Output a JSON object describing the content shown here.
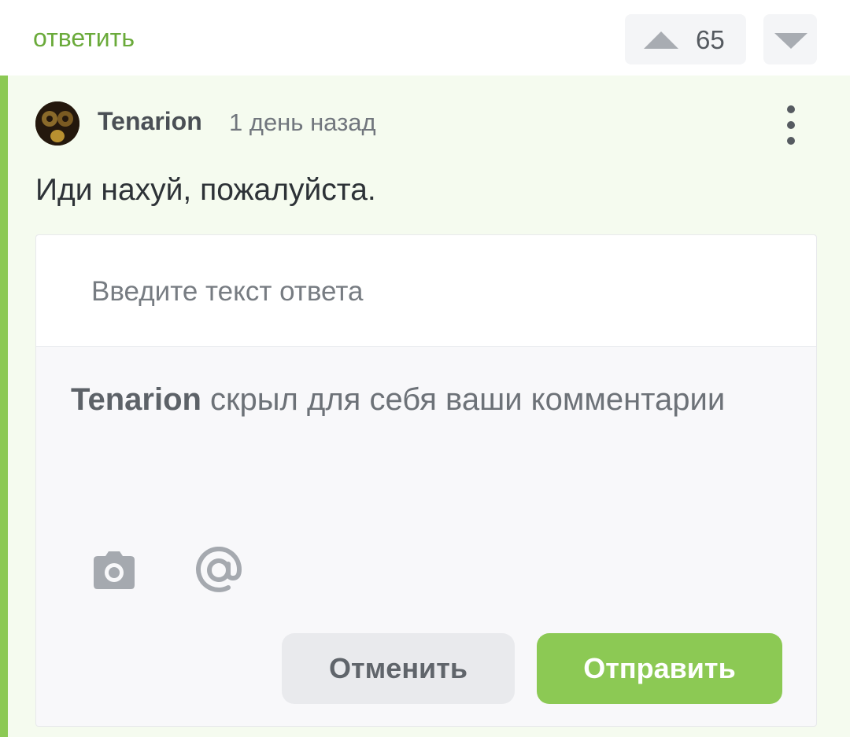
{
  "header": {
    "reply_label": "ответить",
    "rating": "65",
    "upvote_icon": "triangle-up-icon",
    "downvote_icon": "triangle-down-icon"
  },
  "comment": {
    "author": "Tenarion",
    "time": "1 день назад",
    "text": "Иди нахуй, пожалуйста.",
    "avatar_icon": "user-avatar",
    "menu_icon": "more-vertical-icon"
  },
  "reply_form": {
    "placeholder": "Введите текст ответа",
    "notice_author": "Tenarion",
    "notice_text": " скрыл для себя ваши комментарии",
    "camera_icon": "camera-icon",
    "mention_icon": "at-sign-icon",
    "cancel_label": "Отменить",
    "submit_label": "Отправить"
  },
  "colors": {
    "accent_green": "#8cc954",
    "link_green": "#6aaa3a",
    "comment_bg": "#f5fbef"
  }
}
